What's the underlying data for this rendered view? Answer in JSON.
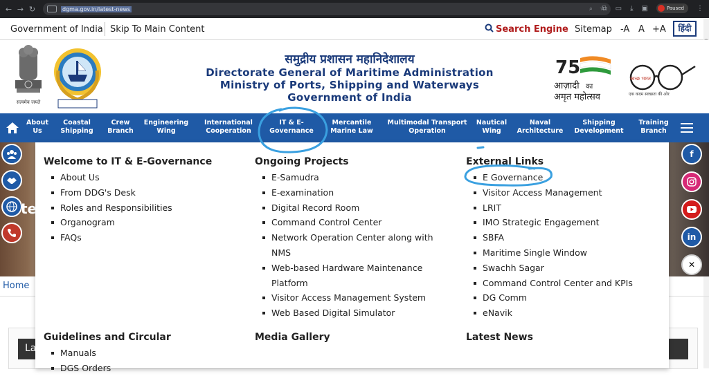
{
  "browser": {
    "url": "dgma.gov.in/latest-news",
    "profile_status": "Paused",
    "profile_initial": "L"
  },
  "topbar": {
    "gov_link": "Government of India",
    "skip_link": "Skip To Main Content",
    "search_label": "Search Engine",
    "sitemap": "Sitemap",
    "font_decrease": "-A",
    "font_normal": "A",
    "font_increase": "+A",
    "language": "हिंदी"
  },
  "header": {
    "title_hindi": "समुद्रीय प्रशासन महानिदेशालय",
    "title_line1": "Directorate General of Maritime Administration",
    "title_line2": "Ministry of Ports, Shipping and Waterways",
    "title_line3": "Government of India",
    "emblem_motto": "सत्यमेव जयते",
    "amrit_number": "75",
    "amrit_text1": "आज़ादी",
    "amrit_text2": "का",
    "amrit_text3": "अमृत महोत्सव",
    "swachh_text": "स्वच्छ भारत",
    "swachh_sub": "एक कदम स्वच्छता की ओर"
  },
  "nav": {
    "items": [
      {
        "line1": "About",
        "line2": "Us"
      },
      {
        "line1": "Coastal",
        "line2": "Shipping"
      },
      {
        "line1": "Crew",
        "line2": "Branch"
      },
      {
        "line1": "Engineering",
        "line2": "Wing"
      },
      {
        "line1": "International",
        "line2": "Cooperation"
      },
      {
        "line1": "IT & E-",
        "line2": "Governance"
      },
      {
        "line1": "Mercantile",
        "line2": "Marine Law"
      },
      {
        "line1": "Multimodal Transport",
        "line2": "Operation"
      },
      {
        "line1": "Nautical",
        "line2": "Wing"
      },
      {
        "line1": "Naval",
        "line2": "Architecture"
      },
      {
        "line1": "Shipping",
        "line2": "Development"
      },
      {
        "line1": "Training",
        "line2": "Branch"
      }
    ]
  },
  "dropdown": {
    "col1": {
      "heading": "Welcome to IT & E-Governance",
      "items": [
        "About Us",
        "From DDG's Desk",
        "Roles and Responsibilities",
        "Organogram",
        "FAQs"
      ],
      "heading2": "Guidelines and Circular",
      "items2": [
        "Manuals",
        "DGS Orders"
      ]
    },
    "col2": {
      "heading": "Ongoing Projects",
      "items": [
        "E-Samudra",
        "E-examination",
        "Digital Record Room",
        "Command Control Center",
        "Network Operation Center along with NMS",
        "Web-based Hardware Maintenance Platform",
        "Visitor Access Management System",
        "Web Based Digital Simulator"
      ],
      "heading2": "Media Gallery"
    },
    "col3": {
      "heading": "External Links",
      "items": [
        "E Governance",
        "Visitor Access Management",
        "LRIT",
        "IMO Strategic Engagement",
        "SBFA",
        "Maritime Single Window",
        "Swachh Sagar",
        "Command Control Center and KPIs",
        "DG Comm",
        "eNavik"
      ],
      "heading2": "Latest News"
    }
  },
  "background": {
    "breadcrumb_home": "Home",
    "banner_text": "te",
    "latest_partial": "La"
  },
  "colors": {
    "nav_blue": "#1f5aa6",
    "title_blue": "#1a3a7a",
    "search_red": "#b01c1c",
    "annotation": "#3aa0e0"
  },
  "social": [
    "facebook-icon",
    "instagram-icon",
    "youtube-icon",
    "linkedin-icon",
    "x-icon"
  ]
}
